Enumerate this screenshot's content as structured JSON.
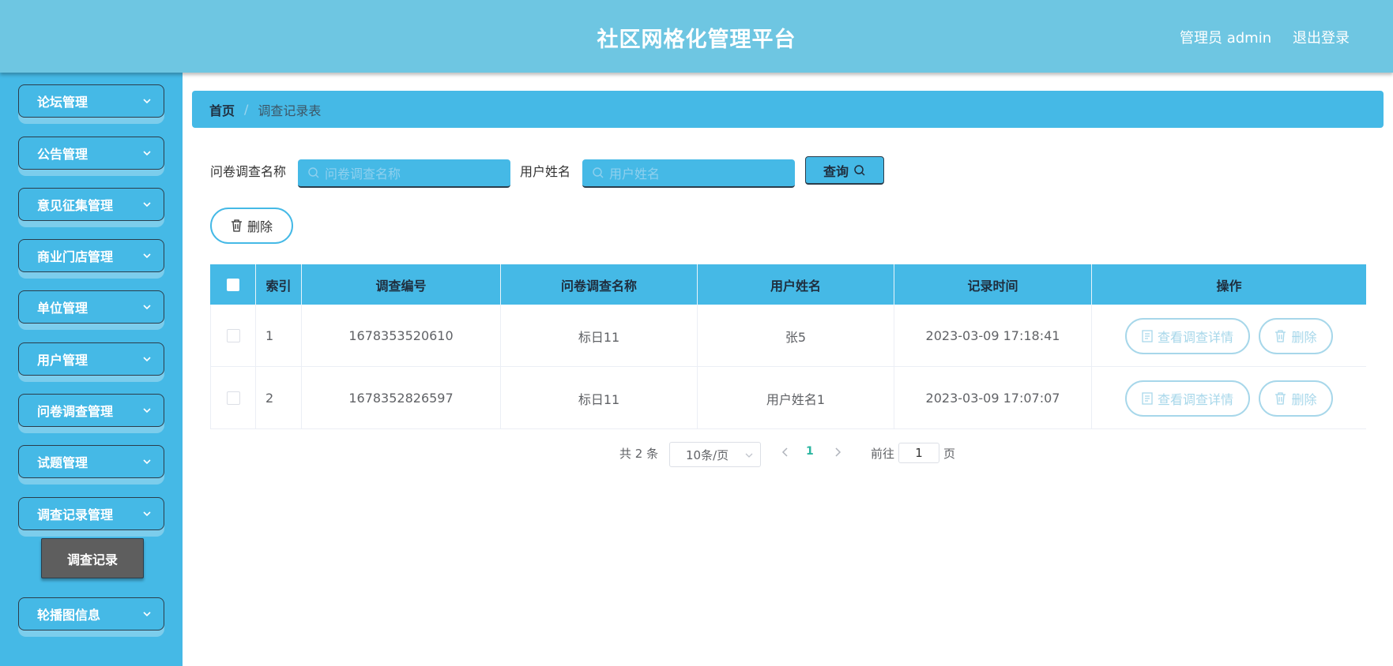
{
  "header": {
    "title": "社区网格化管理平台",
    "user": "管理员 admin",
    "logout": "退出登录"
  },
  "sidebar": {
    "items": [
      {
        "label": "论坛管理"
      },
      {
        "label": "公告管理"
      },
      {
        "label": "意见征集管理"
      },
      {
        "label": "商业门店管理"
      },
      {
        "label": "单位管理"
      },
      {
        "label": "用户管理"
      },
      {
        "label": "问卷调查管理"
      },
      {
        "label": "试题管理"
      },
      {
        "label": "调查记录管理"
      },
      {
        "label": "轮播图信息"
      }
    ],
    "submenu_active": "调查记录"
  },
  "breadcrumb": {
    "home": "首页",
    "separator": "/",
    "current": "调查记录表"
  },
  "search": {
    "survey_name_label": "问卷调查名称",
    "survey_name_placeholder": "问卷调查名称",
    "user_name_label": "用户姓名",
    "user_name_placeholder": "用户姓名",
    "query_label": "查询"
  },
  "toolbar": {
    "delete_label": "删除"
  },
  "table": {
    "columns": [
      "索引",
      "调查编号",
      "问卷调查名称",
      "用户姓名",
      "记录时间",
      "操作"
    ],
    "rows": [
      {
        "index": "1",
        "survey_id": "1678353520610",
        "survey_name": "标日11",
        "user_name": "张5",
        "time": "2023-03-09 17:18:41"
      },
      {
        "index": "2",
        "survey_id": "1678352826597",
        "survey_name": "标日11",
        "user_name": "用户姓名1",
        "time": "2023-03-09 17:07:07"
      }
    ],
    "view_label": "查看调查详情",
    "delete_label": "删除"
  },
  "pagination": {
    "total": "共 2 条",
    "page_size": "10条/页",
    "current_page": "1",
    "goto_label": "前往",
    "goto_value": "1",
    "page_suffix": "页"
  },
  "colors": {
    "primary": "#45b9e6",
    "header": "#6ec6e2",
    "active_submenu": "#5e5e5e",
    "page_active": "#2ab5a0"
  }
}
